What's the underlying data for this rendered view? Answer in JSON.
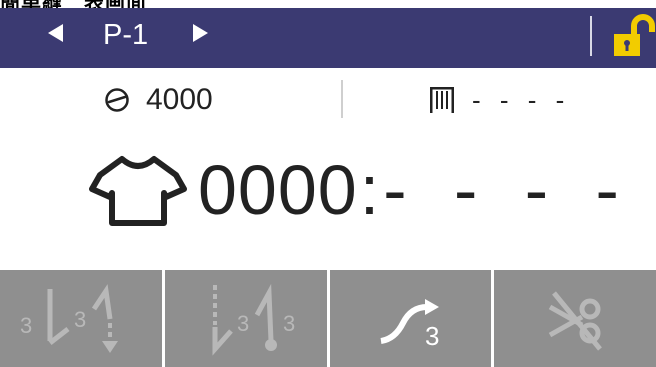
{
  "caption": "簡単縫　表画面",
  "header": {
    "program": "P-1"
  },
  "status": {
    "speed": "4000",
    "stitch_counter": "- - - -"
  },
  "counter": {
    "current": "0000",
    "separator": ":",
    "target": "- - - -"
  },
  "toolbar": {
    "buttons": [
      {
        "icon": "reverse-stitch-start-icon",
        "num_a": "3",
        "num_b": "3"
      },
      {
        "icon": "reverse-stitch-end-icon",
        "num_a": "3",
        "num_b": "3"
      },
      {
        "icon": "thread-trim-3-icon",
        "num": "3"
      },
      {
        "icon": "trimmer-off-icon"
      }
    ]
  },
  "colors": {
    "header_bg": "#3b3a72",
    "lock_yellow": "#f2cc00",
    "toolbar_bg": "#8f8f8f",
    "toolbar_icon": "#b8b8b8"
  }
}
